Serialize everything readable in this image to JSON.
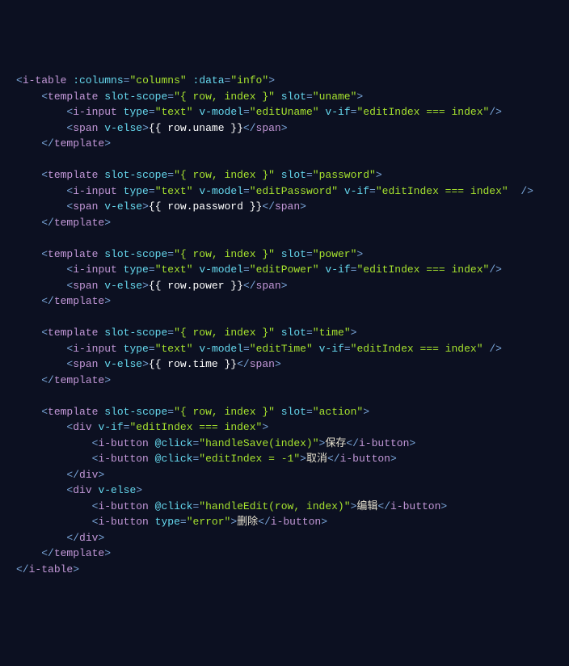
{
  "code": {
    "itable": {
      "columns_attr": ":columns",
      "columns_val": "columns",
      "data_attr": ":data",
      "data_val": "info"
    },
    "slots": {
      "uname": {
        "slotScope": "{ row, index }",
        "slot": "uname",
        "vmodel": "editUname",
        "vif": "editIndex === index",
        "mustache": "{{ row.uname }}"
      },
      "password": {
        "slotScope": "{ row, index }",
        "slot": "password",
        "vmodel": "editPassword",
        "vif": "editIndex === index",
        "mustache": "{{ row.password }}"
      },
      "power": {
        "slotScope": "{ row, index }",
        "slot": "power",
        "vmodel": "editPower",
        "vif": "editIndex === index",
        "mustache": "{{ row.power }}"
      },
      "time": {
        "slotScope": "{ row, index }",
        "slot": "time",
        "vmodel": "editTime",
        "vif": "editIndex === index",
        "mustache": "{{ row.time }}"
      },
      "action": {
        "slotScope": "{ row, index }",
        "slot": "action",
        "vifDiv": "editIndex === index",
        "save": {
          "click": "handleSave(index)",
          "label": "保存"
        },
        "cancel": {
          "click": "editIndex = -1",
          "label": "取消"
        },
        "edit": {
          "click": "handleEdit(row, index)",
          "label": "编辑"
        },
        "delete": {
          "type": "error",
          "label": "删除"
        }
      }
    },
    "common": {
      "type_attr": "type",
      "text_val": "text",
      "vmodel_attr": "v-model",
      "vif_attr": "v-if",
      "velse_attr": "v-else",
      "slotscope_attr": "slot-scope",
      "slot_attr": "slot",
      "click_attr": "@click"
    }
  }
}
